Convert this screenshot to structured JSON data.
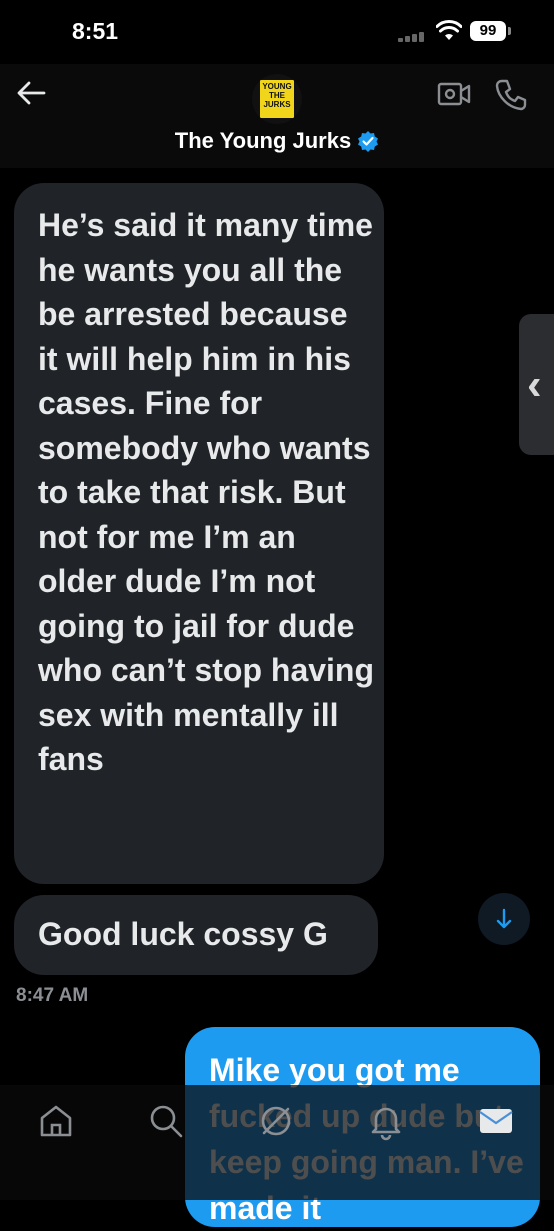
{
  "status_bar": {
    "time": "8:51",
    "battery": "99"
  },
  "header": {
    "avatar_text": "YOUNG THE JURKS",
    "name": "The Young Jurks"
  },
  "messages": {
    "incoming_1": "He’s said it many time he wants you all the be arrested because it will help him in his cases. Fine for somebody who wants to take that risk. But not for me I’m an older dude I’m not going to jail for dude who can’t stop having sex with mentally ill fans",
    "incoming_2": "Good luck cossy G",
    "timestamp": "8:47 AM",
    "outgoing_1": "Mike you got me fucked up dude but keep going man. I’ve made it"
  },
  "colors": {
    "accent": "#1d9bf0",
    "bubble_incoming": "#202327",
    "background": "#000000"
  },
  "icons": {
    "back": "arrow-left-icon",
    "video": "video-camera-icon",
    "phone": "phone-icon",
    "verified": "verified-badge-icon",
    "scroll": "arrow-down-icon",
    "tabs": [
      "home-icon",
      "search-icon",
      "spaces-icon",
      "bell-icon",
      "envelope-icon"
    ]
  }
}
